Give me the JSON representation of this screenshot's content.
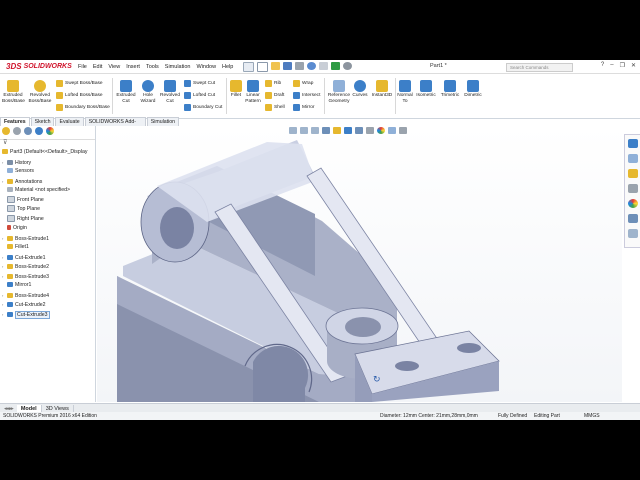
{
  "app": {
    "brand": "SOLIDWORKS",
    "brand_prefix": "3DS",
    "document_title": "Part1 *",
    "search_placeholder": "Search Commands"
  },
  "menu": [
    "File",
    "Edit",
    "View",
    "Insert",
    "Tools",
    "Simulation",
    "Window",
    "Help"
  ],
  "ribbon": {
    "extruded_boss": "Extruded Boss/Base",
    "revolved_boss": "Revolved Boss/Base",
    "swept_boss": "Swept Boss/Base",
    "lofted_boss": "Lofted Boss/Base",
    "boundary_boss": "Boundary Boss/Base",
    "extruded_cut": "Extruded Cut",
    "hole_wizard": "Hole Wizard",
    "revolved_cut": "Revolved Cut",
    "swept_cut": "Swept Cut",
    "lofted_cut": "Lofted Cut",
    "boundary_cut": "Boundary Cut",
    "fillet": "Fillet",
    "linear_pattern": "Linear Pattern",
    "rib": "Rib",
    "draft": "Draft",
    "shell": "Shell",
    "wrap": "Wrap",
    "intersect": "Intersect",
    "mirror": "Mirror",
    "reference_geometry": "Reference Geometry",
    "curves": "Curves",
    "instant3d": "Instant3D",
    "normal_to": "Normal To",
    "isometric": "Isometric",
    "trimetric": "Trimetric",
    "dimetric": "Dimetric"
  },
  "command_tabs": [
    "Features",
    "Sketch",
    "Evaluate",
    "SOLIDWORKS Add-Ins",
    "Simulation"
  ],
  "tree": {
    "root": "Part3 (Default<<Default>_Display",
    "items": [
      "History",
      "Sensors",
      "Annotations",
      "Material <not specified>",
      "Front Plane",
      "Top Plane",
      "Right Plane",
      "Origin",
      "Boss-Extrude1",
      "Fillet1",
      "Cut-Extrude1",
      "Boss-Extrude2",
      "Boss-Extrude3",
      "Mirror1",
      "Boss-Extrude4",
      "Cut-Extrude2",
      "Cut-Extrude3"
    ]
  },
  "model_tabs": [
    "Model",
    "3D Views"
  ],
  "status": {
    "edition": "SOLIDWORKS Premium 2016 x64 Edition",
    "measure": "Diameter: 12mm  Center: 21mm,28mm,0mm",
    "state": "Fully Defined",
    "mode": "Editing Part",
    "units": "MMGS"
  },
  "colors": {
    "brand_red": "#d0142c",
    "model_face_light": "#d3d8ea",
    "model_face_mid": "#b1b8d0",
    "model_face_dark": "#8a92ad",
    "ribbon_blue": "#3c7fc8",
    "ribbon_yellow": "#e6b82e"
  }
}
